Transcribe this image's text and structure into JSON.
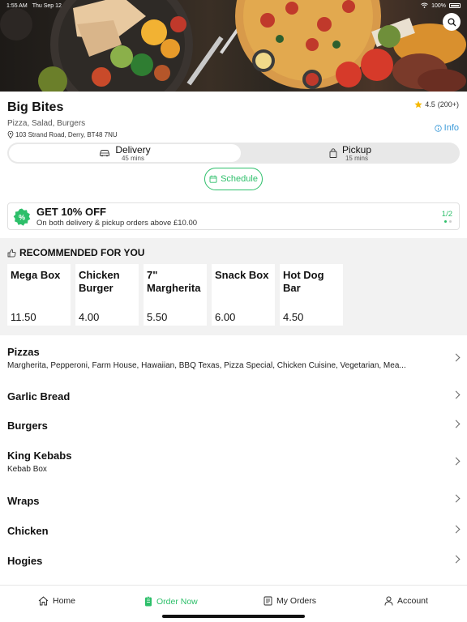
{
  "status_bar": {
    "time": "1:55 AM",
    "date": "Thu Sep 12",
    "battery": "100%"
  },
  "restaurant": {
    "name": "Big Bites",
    "categories": "Pizza, Salad, Burgers",
    "address": "103 Strand Road, Derry, BT48 7NU",
    "rating": "4.5",
    "rating_count": "(200+)",
    "info_label": "Info"
  },
  "order_type": {
    "delivery": {
      "label": "Delivery",
      "time": "45 mins"
    },
    "pickup": {
      "label": "Pickup",
      "time": "15 mins"
    },
    "selected": "delivery"
  },
  "schedule_label": "Schedule",
  "promo": {
    "title": "GET 10% OFF",
    "subtitle": "On both delivery & pickup orders above £10.00",
    "page": "1/2"
  },
  "recommended": {
    "heading": "RECOMMENDED FOR YOU",
    "items": [
      {
        "name": "Mega Box",
        "price": "11.50"
      },
      {
        "name": "Chicken Burger",
        "price": "4.00"
      },
      {
        "name": "7\" Margherita",
        "price": "5.50"
      },
      {
        "name": "Snack Box",
        "price": "6.00"
      },
      {
        "name": "Hot Dog Bar",
        "price": "4.50"
      }
    ]
  },
  "menu": [
    {
      "title": "Pizzas",
      "subtitle": "Margherita, Pepperoni, Farm House, Hawaiian, BBQ Texas, Pizza Special, Chicken Cuisine, Vegetarian, Mea..."
    },
    {
      "title": "Garlic Bread",
      "subtitle": ""
    },
    {
      "title": "Burgers",
      "subtitle": ""
    },
    {
      "title": "King Kebabs",
      "subtitle": "Kebab Box"
    },
    {
      "title": "Wraps",
      "subtitle": ""
    },
    {
      "title": "Chicken",
      "subtitle": ""
    },
    {
      "title": "Hogies",
      "subtitle": ""
    }
  ],
  "tabs": [
    {
      "label": "Home",
      "icon": "home-icon"
    },
    {
      "label": "Order Now",
      "icon": "order-icon"
    },
    {
      "label": "My Orders",
      "icon": "receipt-icon"
    },
    {
      "label": "Account",
      "icon": "person-icon"
    }
  ],
  "colors": {
    "accent": "#2dbf6a",
    "link": "#3b9ad9",
    "star": "#f5b800"
  }
}
